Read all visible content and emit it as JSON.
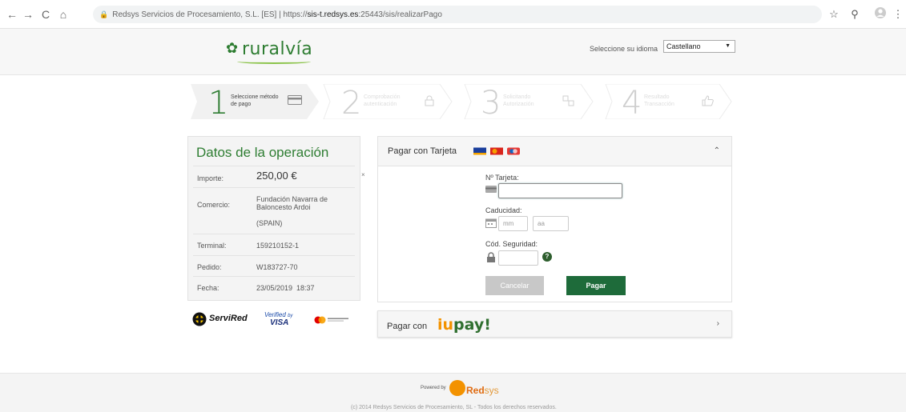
{
  "browser": {
    "back": "←",
    "forward": "→",
    "reload": "C",
    "home": "⌂",
    "site_name": "Redsys Servicios de Procesamiento, S.L. [ES]",
    "separator": "|",
    "url_scheme": "https://",
    "url_host": "sis-t.redsys.es",
    "url_rest": ":25443/sis/realizarPago"
  },
  "header": {
    "brand": "ruralvía",
    "language_label": "Seleccione su idioma",
    "language_value": "Castellano"
  },
  "steps": [
    {
      "number": "1",
      "text": "Seleccione método de pago",
      "icon": "card-icon",
      "active": true
    },
    {
      "number": "2",
      "text": "Comprobación autenticación",
      "icon": "lock-icon",
      "active": false
    },
    {
      "number": "3",
      "text": "Solicitando Autorización",
      "icon": "exchange-icon",
      "active": false
    },
    {
      "number": "4",
      "text": "Resultado Transacción",
      "icon": "thumb-up-icon",
      "active": false
    }
  ],
  "operation": {
    "title": "Datos de la operación",
    "rows": [
      {
        "label": "Importe:",
        "value": "250,00 €"
      },
      {
        "label": "Comercio:",
        "value": "Fundación Navarra de Baloncesto Ardoi",
        "extra": "(SPAIN)"
      },
      {
        "label": "Terminal:",
        "value": "159210152-1"
      },
      {
        "label": "Pedido:",
        "value": "W183727-70"
      },
      {
        "label": "Fecha:",
        "value": "23/05/2019  18:37"
      }
    ],
    "close": "×"
  },
  "brands": {
    "servired": "ServiRed",
    "verified_line1": "Verified",
    "verified_by": "by",
    "verified_line2": "VISA"
  },
  "card": {
    "title": "Pagar con Tarjeta",
    "pan_label": "Nº Tarjeta:",
    "expiry_label": "Caducidad:",
    "month_placeholder": "mm",
    "year_placeholder": "aa",
    "cvv_label": "Cód. Seguridad:",
    "help": "?",
    "cancel": "Cancelar",
    "pay": "Pagar"
  },
  "iupay": {
    "label": "Pagar con",
    "logo_i": "iu",
    "logo_pay": "pay!"
  },
  "footer": {
    "powered_by": "Powered by",
    "redsys_red": "Red",
    "redsys_sys": "sys",
    "copyright": "(c) 2014 Redsys Servicios de Procesamiento, SL - Todos los derechos reservados."
  },
  "colors": {
    "brand_green": "#2e7d32",
    "pay_button": "#1e6b3a",
    "redsys_orange": "#f39200"
  }
}
